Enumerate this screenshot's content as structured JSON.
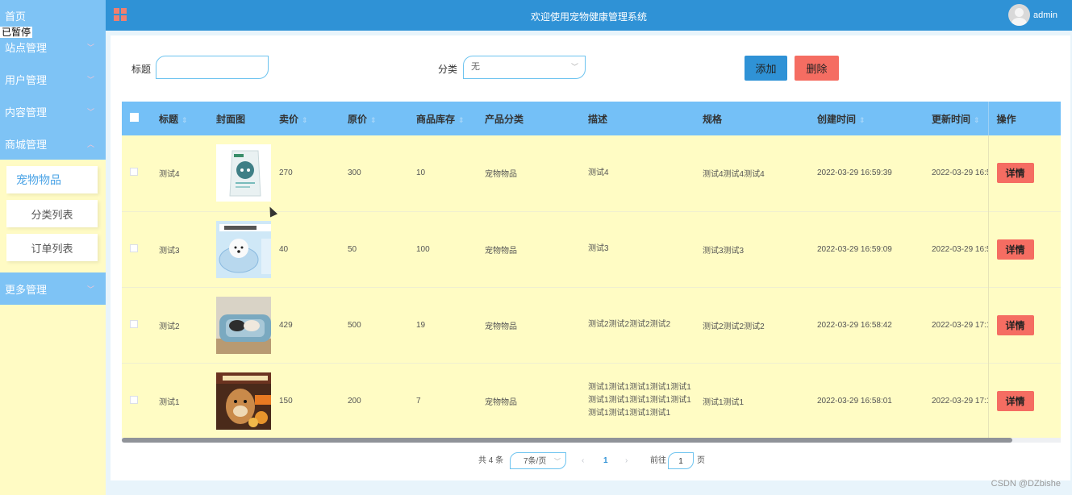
{
  "sidebar": {
    "home_label": "首页",
    "paused_label": "已暂停",
    "items": [
      {
        "label": "站点管理"
      },
      {
        "label": "用户管理"
      },
      {
        "label": "内容管理"
      },
      {
        "label": "商城管理"
      }
    ],
    "sub_items": [
      {
        "label": "宠物物品"
      },
      {
        "label": "分类列表"
      },
      {
        "label": "订单列表"
      }
    ],
    "more_label": "更多管理"
  },
  "header": {
    "title": "欢迎使用宠物健康管理系统",
    "user": "admin"
  },
  "filter": {
    "title_label": "标题",
    "title_value": "",
    "category_label": "分类",
    "category_value": "无",
    "add_label": "添加",
    "delete_label": "删除"
  },
  "table": {
    "columns": [
      "标题",
      "封面图",
      "卖价",
      "原价",
      "商品库存",
      "产品分类",
      "描述",
      "规格",
      "创建时间",
      "更新时间",
      "操作"
    ],
    "rows": [
      {
        "title": "测试4",
        "cover": "pet-food-bag",
        "price": "270",
        "original": "300",
        "stock": "10",
        "category": "宠物物品",
        "desc": "测试4",
        "spec": "测试4测试4测试4",
        "created": "2022-03-29 16:59:39",
        "updated": "2022-03-29 16:5",
        "action": "详情"
      },
      {
        "title": "测试3",
        "cover": "protective-collar",
        "price": "40",
        "original": "50",
        "stock": "100",
        "category": "宠物物品",
        "desc": "测试3",
        "spec": "测试3测试3",
        "created": "2022-03-29 16:59:09",
        "updated": "2022-03-29 16:5",
        "action": "详情"
      },
      {
        "title": "测试2",
        "cover": "pet-bed",
        "price": "429",
        "original": "500",
        "stock": "19",
        "category": "宠物物品",
        "desc": "测试2测试2测试2测试2",
        "spec": "测试2测试2测试2",
        "created": "2022-03-29 16:58:42",
        "updated": "2022-03-29 17:1",
        "action": "详情"
      },
      {
        "title": "测试1",
        "cover": "dog-treat-pack",
        "price": "150",
        "original": "200",
        "stock": "7",
        "category": "宠物物品",
        "desc": "测试1测试1测试1测试1测试1测试1测试1测试1测试1测试1测试1测试1测试1测试1",
        "spec": "测试1测试1",
        "created": "2022-03-29 16:58:01",
        "updated": "2022-03-29 17:1",
        "action": "详情"
      }
    ]
  },
  "pager": {
    "total": "共 4 条",
    "page_size": "7条/页",
    "prev": "‹",
    "current": "1",
    "next": "›",
    "goto_label": "前往",
    "goto_value": "1",
    "page_suffix": "页"
  },
  "watermark": "CSDN @DZbishe",
  "colors": {
    "header": "#2f92d6",
    "sidebar_menu": "#7ec3f5",
    "sidebar_bg": "#fffbc4",
    "table_head": "#74c0f7",
    "row_bg": "#fffcc4",
    "danger": "#f56d62"
  }
}
